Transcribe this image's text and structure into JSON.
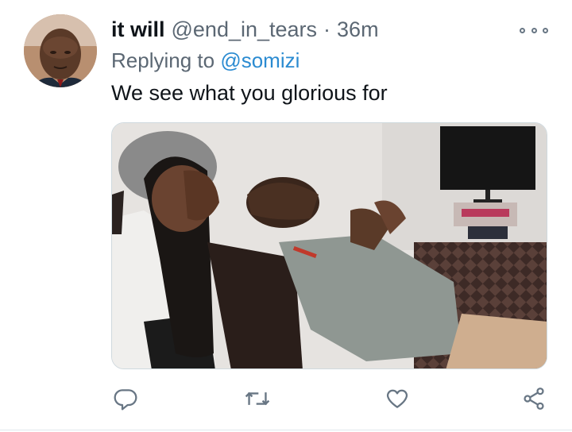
{
  "tweet": {
    "author_name": "it will",
    "author_handle": "@end_in_tears",
    "separator": "·",
    "time": "36m",
    "replying_prefix": "Replying to",
    "replying_to": "@somizi",
    "text": "We see what you glorious for"
  },
  "icons": {
    "more": "more-options-icon",
    "reply": "reply-icon",
    "retweet": "retweet-icon",
    "like": "heart-icon",
    "share": "share-icon"
  },
  "colors": {
    "link": "#2b8bd1",
    "secondary_text": "#5b6773",
    "icon": "#687684"
  }
}
